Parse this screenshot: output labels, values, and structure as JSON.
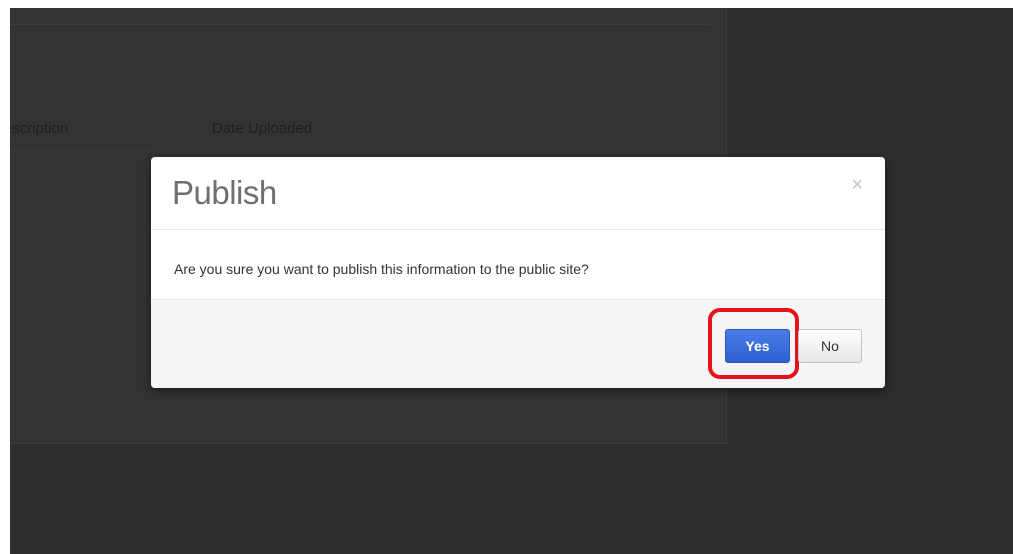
{
  "background_table": {
    "columns": [
      "escription",
      "Date Uploaded"
    ]
  },
  "dialog": {
    "title": "Publish",
    "close_symbol": "×",
    "message": "Are you sure you want to publish this information to the public site?",
    "yes_label": "Yes",
    "no_label": "No"
  },
  "colors": {
    "backdrop": "#2e2e2e",
    "primary_button": "#3b6be0",
    "highlight": "#e4121b"
  },
  "icons": {
    "close": "close-icon"
  }
}
